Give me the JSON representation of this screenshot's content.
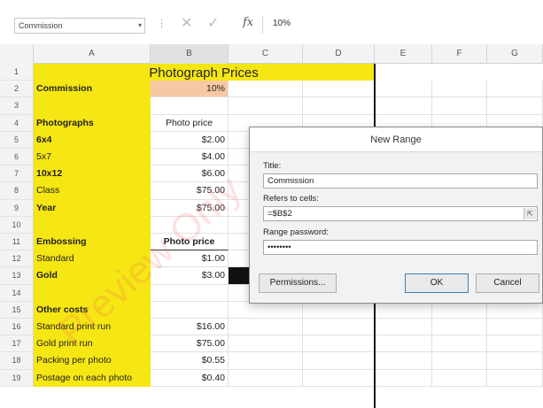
{
  "formula_bar": {
    "name_box_value": "Commission",
    "name_box_arrow": "▾",
    "separator": "⋮",
    "cancel_icon": "✕",
    "enter_icon": "✓",
    "fx_label": "fx",
    "content": "10%"
  },
  "columns": [
    "A",
    "B",
    "C",
    "D",
    "E",
    "F",
    "G"
  ],
  "rows": [
    {
      "num": "1",
      "a": "Photograph Prices",
      "b": "",
      "title": true
    },
    {
      "num": "2",
      "a": "Commission",
      "b": "10%"
    },
    {
      "num": "3",
      "a": "",
      "b": ""
    },
    {
      "num": "4",
      "a": "Photographs",
      "b": "Photo price"
    },
    {
      "num": "5",
      "a": "6x4",
      "b": "$2.00"
    },
    {
      "num": "6",
      "a": "5x7",
      "b": "$4.00"
    },
    {
      "num": "7",
      "a": "10x12",
      "b": "$6.00"
    },
    {
      "num": "8",
      "a": "Class",
      "b": "$75.00"
    },
    {
      "num": "9",
      "a": "Year",
      "b": "$75.00"
    },
    {
      "num": "10",
      "a": "",
      "b": ""
    },
    {
      "num": "11",
      "a": "Embossing",
      "b": "Photo price"
    },
    {
      "num": "12",
      "a": "Standard",
      "b": "$1.00"
    },
    {
      "num": "13",
      "a": "Gold",
      "b": "$3.00"
    },
    {
      "num": "14",
      "a": "",
      "b": ""
    },
    {
      "num": "15",
      "a": "Other costs",
      "b": ""
    },
    {
      "num": "16",
      "a": "Standard print run",
      "b": "$16.00"
    },
    {
      "num": "17",
      "a": "Gold print run",
      "b": "$75.00"
    },
    {
      "num": "18",
      "a": "Packing per photo",
      "b": "$0.55"
    },
    {
      "num": "19",
      "a": "Postage on each photo",
      "b": "$0.40"
    }
  ],
  "dialog": {
    "title": "New Range",
    "title_label": "Title:",
    "title_value": "Commission",
    "refers_label": "Refers to cells:",
    "refers_value": "=$B$2",
    "refers_button": "⇱",
    "password_label": "Range password:",
    "password_value": "••••••••",
    "permissions_button": "Permissions...",
    "ok_button": "OK",
    "cancel_button": "Cancel"
  },
  "watermark": "Preview Only",
  "colors": {
    "yellow": "#f5e614",
    "peach": "#f7c8a3"
  }
}
